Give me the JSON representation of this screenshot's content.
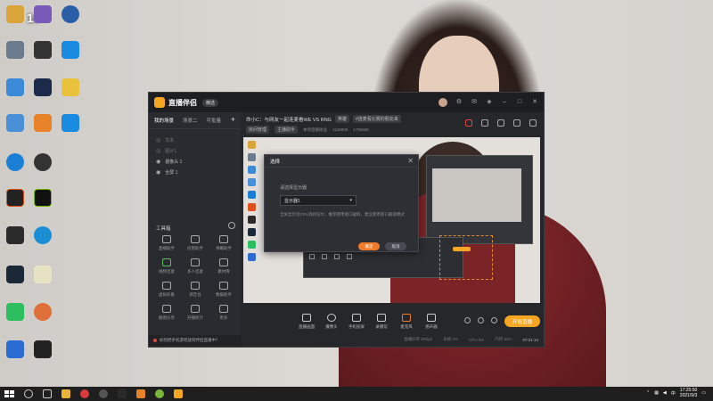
{
  "page_label": "18",
  "desktop_icons": [
    {
      "label": "",
      "color": "#d9a43a",
      "x_row": 0
    },
    {
      "label": "",
      "color": "#4a6ca8"
    },
    {
      "label": "",
      "color": "#2a6fd4"
    }
  ],
  "app": {
    "title": "直播伴侣",
    "badge": "精选",
    "scene_tabs": [
      "我的场景",
      "场景二",
      "可批量"
    ],
    "sources": [
      {
        "label": "文本",
        "on": false
      },
      {
        "label": "图片1",
        "on": false
      },
      {
        "label": "摄像头 1",
        "on": true
      },
      {
        "label": "全屏 1",
        "on": true
      }
    ],
    "tools_title": "工具箱",
    "tools": [
      "直播助手",
      "房管助手",
      "弹幕助手",
      "视频连麦",
      "多人连麦",
      "素材库",
      "虚拟形象",
      "调音台",
      "数据助手",
      "截图分享",
      "开播统计",
      "更多"
    ],
    "tip": "如何把手机游戏放到伴侣直播中？",
    "room_title": "命小C：与网友一起连麦看WE VS RNG",
    "room_tag": "英雄",
    "room_extra": "#连麦看比赛的朋友来",
    "room_meta": [
      "房间管理",
      "主播助手",
      "本场直播收益",
      "1128888",
      "1785685"
    ],
    "controls": [
      "直播画面",
      "摄像头",
      "手机投屏",
      "录播馆",
      "麦克风",
      "扬声器"
    ],
    "live_button": "开始直播",
    "status": [
      "直播码率 0Kbps",
      "丢帧 0%",
      "CPU 9%",
      "内存 52%"
    ],
    "timer": "07:21:14"
  },
  "dialog": {
    "title": "选择",
    "label": "请选择显示器",
    "selected": "显示器1",
    "hint": "全屏显示对CPU消耗较大，推荐使用窗口截取，建议使用窗口截取模式",
    "ok": "确定",
    "cancel": "取消"
  },
  "taskbar": {
    "time": "17:25:50",
    "date": "2021/9/3"
  }
}
